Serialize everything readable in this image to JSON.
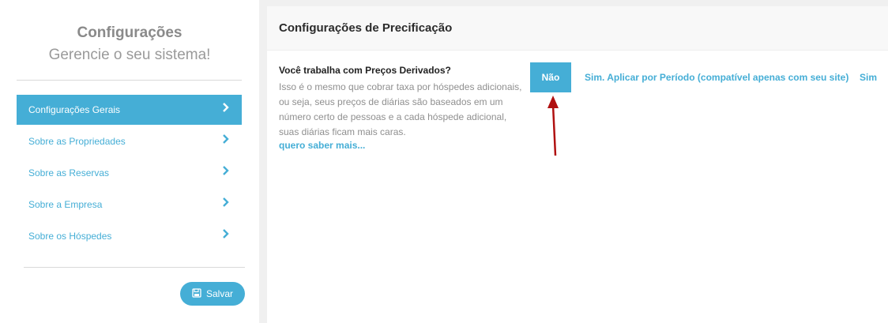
{
  "sidebar": {
    "title": "Configurações",
    "subtitle": "Gerencie o seu sistema!",
    "items": [
      {
        "label": "Configurações Gerais",
        "active": true
      },
      {
        "label": "Sobre as Propriedades",
        "active": false
      },
      {
        "label": "Sobre as Reservas",
        "active": false
      },
      {
        "label": "Sobre a Empresa",
        "active": false
      },
      {
        "label": "Sobre os Hóspedes",
        "active": false
      }
    ],
    "save_label": "Salvar"
  },
  "main": {
    "title": "Configurações de Precificação",
    "question": "Você trabalha com Preços Derivados?",
    "description": "Isso é o mesmo que cobrar taxa por hóspedes adicionais, ou seja, seus preços de diárias são baseados em um número certo de pessoas e a cada hóspede adicional, suas diárias ficam mais caras.",
    "more_link": "quero saber mais...",
    "options": {
      "no": "Não",
      "period": "Sim. Aplicar por Período (compatível apenas com seu site)",
      "yes": "Sim"
    }
  },
  "colors": {
    "accent": "#45aed6",
    "annotation_arrow": "#b01010"
  },
  "icons": {
    "chevron": "chevron-right-icon",
    "save": "floppy-disk-icon",
    "annotation": "red-arrow-up-icon"
  }
}
